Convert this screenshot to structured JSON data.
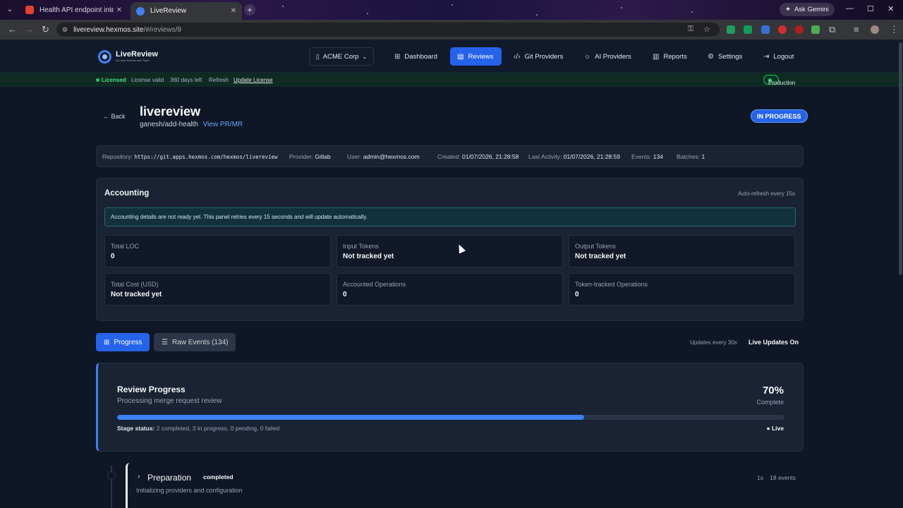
{
  "browser": {
    "tabs": [
      {
        "label": "Health API endpoint integration",
        "favicon_color": "#e24329"
      },
      {
        "label": "LiveReview",
        "favicon_color": "#3b82f6"
      }
    ],
    "ask_gemini": "Ask Gemini",
    "url_host": "livereview.hexmos.site",
    "url_path": "/#/reviews/9"
  },
  "header": {
    "logo_name": "LiveReview",
    "logo_tagline": "AI Code Review with Team",
    "org": "ACME Corp",
    "nav": [
      {
        "label": "Dashboard",
        "icon": "grid-icon"
      },
      {
        "label": "Reviews",
        "icon": "document-icon",
        "active": true
      },
      {
        "label": "Git Providers",
        "icon": "code-icon"
      },
      {
        "label": "AI Providers",
        "icon": "bulb-icon"
      },
      {
        "label": "Reports",
        "icon": "bar-chart-icon"
      },
      {
        "label": "Settings",
        "icon": "gear-icon"
      },
      {
        "label": "Logout",
        "icon": "logout-icon"
      }
    ]
  },
  "license": {
    "status": "Licensed",
    "valid": "License valid",
    "days_left": "360 days left",
    "refresh": "Refresh",
    "update": "Update License",
    "env": "Production"
  },
  "review": {
    "back": "← Back",
    "title": "livereview",
    "branch": "ganesh/add-health",
    "view_link": "View PR/MR",
    "status": "IN PROGRESS"
  },
  "info": {
    "repository_label": "Repository:",
    "repository": "https://git.apps.hexmos.com/hexmos/livereview",
    "provider_label": "Provider:",
    "provider": "Gitlab",
    "user_label": "User:",
    "user": "admin@hexmos.com",
    "created_label": "Created:",
    "created": "01/07/2026, 21:28:58",
    "activity_label": "Last Activity:",
    "activity": "01/07/2026, 21:28:59",
    "events_label": "Events:",
    "events": "134",
    "batches_label": "Batches:",
    "batches": "1"
  },
  "accounting": {
    "title": "Accounting",
    "auto_refresh": "Auto-refresh every 15s",
    "notice": "Accounting details are not ready yet. This panel retries every 15 seconds and will update automatically.",
    "metrics": [
      {
        "label": "Total LOC",
        "value": "0"
      },
      {
        "label": "Input Tokens",
        "value": "Not tracked yet"
      },
      {
        "label": "Output Tokens",
        "value": "Not tracked yet"
      },
      {
        "label": "Total Cost (USD)",
        "value": "Not tracked yet"
      },
      {
        "label": "Accounted Operations",
        "value": "0"
      },
      {
        "label": "Token-tracked Operations",
        "value": "0"
      }
    ]
  },
  "tabs": {
    "progress": "Progress",
    "raw_events": "Raw Events (134)",
    "updates": "Updates every 30s",
    "live_updates": "Live Updates On"
  },
  "progress": {
    "title": "Review Progress",
    "subtitle": "Processing merge request review",
    "percent_label": "70%",
    "percent": 0.7,
    "complete": "Complete",
    "stage_status_label": "Stage status:",
    "stage_status": "2 completed, 3 in progress, 0 pending, 0 failed",
    "live": "● Live"
  },
  "stage": {
    "name": "Preparation",
    "badge": "completed",
    "description": "Initializing providers and configuration",
    "duration": "1s",
    "events": "18 events"
  }
}
